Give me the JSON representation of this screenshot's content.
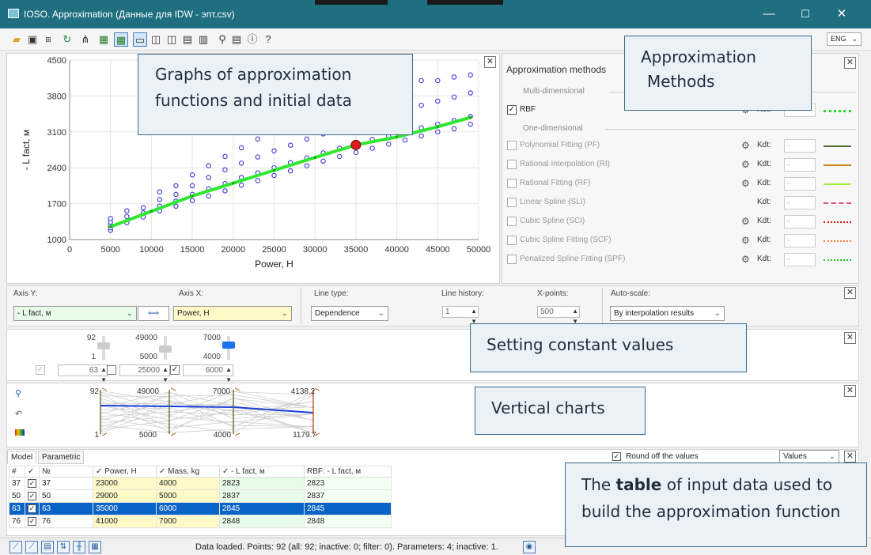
{
  "window": {
    "title": "IOSO. Approximation (Данные для IDW - эпт.csv)",
    "minimize": "—",
    "maximize": "☐",
    "close": "✕"
  },
  "toolbar": {
    "language": "ENG",
    "icons": [
      "open-folder-icon",
      "save-icon",
      "excel-export-icon",
      "refresh-icon",
      "scatter-tool-icon",
      "grid-add-icon",
      "grid-select-icon",
      "layout-1-icon",
      "layout-2-icon",
      "layout-3-icon",
      "layout-4-icon",
      "layout-5-icon",
      "filter-tool-icon",
      "save-settings-icon",
      "info-icon",
      "help-icon"
    ],
    "info": "ⓘ",
    "help": "?"
  },
  "chart": {
    "ylabel": "- L fact, м",
    "xlabel": "Power, H",
    "xticks": [
      "0",
      "5000",
      "10000",
      "15000",
      "20000",
      "25000",
      "30000",
      "35000",
      "40000",
      "45000",
      "50000"
    ],
    "yticks": [
      "1000",
      "1700",
      "2400",
      "3100",
      "3800",
      "4500"
    ]
  },
  "chart_data": {
    "type": "scatter",
    "xlabel": "Power, H",
    "ylabel": "- L fact, м",
    "xlim": [
      0,
      50000
    ],
    "ylim": [
      1000,
      4500
    ],
    "grid": true,
    "series": [
      {
        "name": "RBF",
        "kind": "line",
        "color": "#2ee82e",
        "points": [
          [
            5000,
            1250
          ],
          [
            10000,
            1550
          ],
          [
            15000,
            1850
          ],
          [
            20000,
            2100
          ],
          [
            25000,
            2350
          ],
          [
            30000,
            2600
          ],
          [
            35000,
            2845
          ],
          [
            40000,
            3000
          ],
          [
            45000,
            3200
          ],
          [
            49000,
            3380
          ]
        ]
      },
      {
        "kind": "markers",
        "color": "#3d3dd8",
        "points": [
          [
            5000,
            1180
          ],
          [
            5000,
            1230
          ],
          [
            5000,
            1280
          ],
          [
            5000,
            1340
          ],
          [
            5000,
            1410
          ],
          [
            7000,
            1330
          ],
          [
            7000,
            1450
          ],
          [
            7000,
            1560
          ],
          [
            9000,
            1440
          ],
          [
            9000,
            1520
          ],
          [
            9000,
            1620
          ],
          [
            11000,
            1560
          ],
          [
            11000,
            1650
          ],
          [
            11000,
            1780
          ],
          [
            11000,
            1930
          ],
          [
            13000,
            1650
          ],
          [
            13000,
            1750
          ],
          [
            13000,
            1880
          ],
          [
            13000,
            2050
          ],
          [
            15000,
            1760
          ],
          [
            15000,
            1880
          ],
          [
            15000,
            2050
          ],
          [
            15000,
            2260
          ],
          [
            17000,
            1850
          ],
          [
            17000,
            1990
          ],
          [
            17000,
            2210
          ],
          [
            17000,
            2440
          ],
          [
            19000,
            1950
          ],
          [
            19000,
            2090
          ],
          [
            19000,
            2360
          ],
          [
            19000,
            2620
          ],
          [
            21000,
            2060
          ],
          [
            21000,
            2210
          ],
          [
            21000,
            2490
          ],
          [
            21000,
            2790
          ],
          [
            23000,
            2150
          ],
          [
            23000,
            2300
          ],
          [
            23000,
            2610
          ],
          [
            23000,
            2960
          ],
          [
            25000,
            2250
          ],
          [
            25000,
            2400
          ],
          [
            25000,
            2730
          ],
          [
            25000,
            3090
          ],
          [
            27000,
            2340
          ],
          [
            27000,
            2500
          ],
          [
            27000,
            2840
          ],
          [
            27000,
            3250
          ],
          [
            29000,
            2440
          ],
          [
            29000,
            2590
          ],
          [
            29000,
            2960
          ],
          [
            29000,
            3400
          ],
          [
            31000,
            2530
          ],
          [
            31000,
            2690
          ],
          [
            31000,
            3060
          ],
          [
            31000,
            3530
          ],
          [
            33000,
            2620
          ],
          [
            33000,
            2780
          ],
          [
            33000,
            3170
          ],
          [
            33000,
            3640
          ],
          [
            35000,
            2700
          ],
          [
            35000,
            2860
          ],
          [
            35000,
            3260
          ],
          [
            35000,
            3750
          ],
          [
            37000,
            2780
          ],
          [
            37000,
            2950
          ],
          [
            37000,
            3350
          ],
          [
            37000,
            3880
          ],
          [
            39000,
            2860
          ],
          [
            39000,
            3020
          ],
          [
            39000,
            3450
          ],
          [
            39000,
            3990
          ],
          [
            41000,
            2940
          ],
          [
            41000,
            3100
          ],
          [
            41000,
            3540
          ],
          [
            41000,
            4080
          ],
          [
            43000,
            3020
          ],
          [
            43000,
            3180
          ],
          [
            43000,
            3620
          ],
          [
            43000,
            4100
          ],
          [
            45000,
            3100
          ],
          [
            45000,
            3250
          ],
          [
            45000,
            3700
          ],
          [
            45000,
            4100
          ],
          [
            47000,
            3160
          ],
          [
            47000,
            3320
          ],
          [
            47000,
            3780
          ],
          [
            47000,
            4170
          ],
          [
            49000,
            3250
          ],
          [
            49000,
            3400
          ],
          [
            49000,
            3860
          ],
          [
            49000,
            4210
          ]
        ]
      },
      {
        "kind": "highlight",
        "color": "#d42020",
        "points": [
          [
            35000,
            2845
          ]
        ]
      }
    ]
  },
  "methods": {
    "header": "Approximation methods",
    "multi_label": "Multi-dimensional",
    "one_label": "One-dimensional",
    "kdt_label": "Kdt:",
    "rbf": {
      "name": "RBF",
      "checked": "✓",
      "color": "#22dd22"
    },
    "one_dim": [
      {
        "name": "Polynomial Fitting (PF)",
        "value": "-",
        "color": "#556b2f",
        "style": "solid"
      },
      {
        "name": "Rational Interpolation (RI)",
        "value": "-",
        "color": "#c58a1f",
        "style": "solid"
      },
      {
        "name": "Rational Fitting (RF)",
        "value": "-",
        "color": "#a6ee3a",
        "style": "solid"
      },
      {
        "name": "Linear Spline (SLI)",
        "value": "-",
        "color": "#ee4a8a",
        "style": "dashed"
      },
      {
        "name": "Cubic Spline (SCI)",
        "value": "-",
        "color": "#d81818",
        "style": "dotted"
      },
      {
        "name": "Cubic Spline Fitting (SCF)",
        "value": "-",
        "color": "#ff7a3a",
        "style": "dotted"
      },
      {
        "name": "Penalized Spline Fitting (SPF)",
        "value": "-",
        "color": "#28c828",
        "style": "dotted"
      }
    ]
  },
  "axis": {
    "y_label": "Axis Y:",
    "y_value": "- L fact, м",
    "x_label": "Axis X:",
    "x_value": "Power, H",
    "swap": "⟺",
    "line_type_label": "Line type:",
    "line_type_value": "Dependence",
    "history_label": "Line history:",
    "history_value": "1",
    "xpoints_label": "X-points:",
    "xpoints_value": "500",
    "autoscale_label": "Auto-scale:",
    "autoscale_value": "By interpolation results"
  },
  "constants": {
    "sliders": [
      {
        "max": "92",
        "min": "1",
        "value": "63",
        "checked": false,
        "thumb": 0.6
      },
      {
        "max": "49000",
        "min": "5000",
        "value": "25000",
        "checked": false,
        "thumb": 0.45
      },
      {
        "max": "7000",
        "min": "4000",
        "value": "6000",
        "checked": true,
        "thumb": 0.67
      }
    ]
  },
  "vcharts": {
    "axes": [
      {
        "top": "92",
        "bottom": "1"
      },
      {
        "top": "49000",
        "bottom": "5000"
      },
      {
        "top": "7000",
        "bottom": "4000"
      },
      {
        "top": "4138.2",
        "bottom": "1179.7"
      }
    ]
  },
  "table": {
    "tabs": [
      "Model",
      "Parametric"
    ],
    "round_label": "Round off the values",
    "round_checked": "✓",
    "values_select": "Values",
    "headers": [
      "#",
      "✓",
      "№",
      "✓ Power, H",
      "✓ Mass, kg",
      "✓ - L fact, м",
      "RBF: - L fact, м"
    ],
    "rows": [
      {
        "idx": "37",
        "chk": "✓",
        "no": "37",
        "power": "23000",
        "mass": "4000",
        "lfact": "2823",
        "rbf": "2823"
      },
      {
        "idx": "50",
        "chk": "✓",
        "no": "50",
        "power": "29000",
        "mass": "5000",
        "lfact": "2837",
        "rbf": "2837"
      },
      {
        "idx": "63",
        "chk": "✓",
        "no": "63",
        "power": "35000",
        "mass": "6000",
        "lfact": "2845",
        "rbf": "2845"
      },
      {
        "idx": "76",
        "chk": "✓",
        "no": "76",
        "power": "41000",
        "mass": "7000",
        "lfact": "2848",
        "rbf": "2848"
      }
    ]
  },
  "status": {
    "text": "Data loaded.  Points: 92 (all: 92; inactive: 0; filter: 0).  Parameters: 4; inactive: 1."
  },
  "callouts": {
    "graphs_line1": "Graphs of approximation",
    "graphs_line2": "functions and initial data",
    "methods_line1": "Approximation",
    "methods_line2": "Methods",
    "constants": "Setting constant values",
    "vertical": "Vertical charts",
    "table_pre": "The ",
    "table_bold": "table",
    "table_post": " of input data used to",
    "table_line2": "build the approximation function"
  }
}
